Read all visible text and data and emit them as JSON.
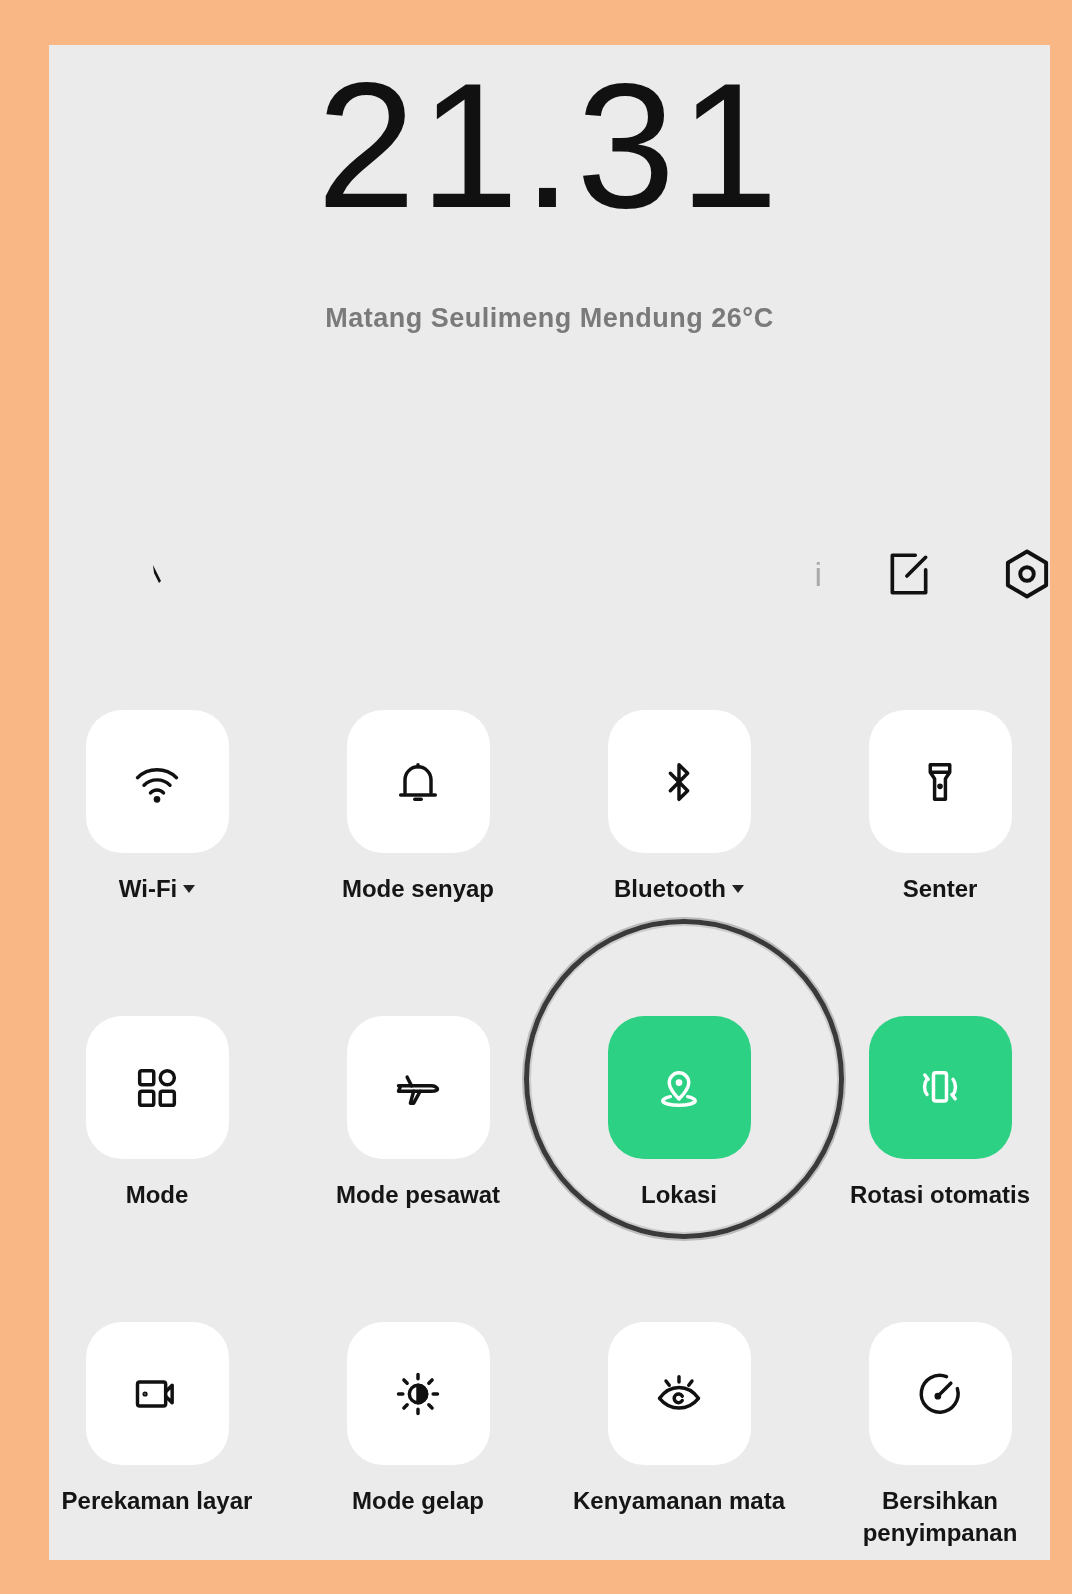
{
  "clock": {
    "time": "21.31",
    "weather": "Matang Seulimeng Mendung 26°C"
  },
  "header": {
    "info": "i"
  },
  "tiles": [
    {
      "label": "Wi-Fi",
      "on": false,
      "menu": true,
      "highlighted": false
    },
    {
      "label": "Mode senyap",
      "on": false,
      "menu": false,
      "highlighted": false
    },
    {
      "label": "Bluetooth",
      "on": false,
      "menu": true,
      "highlighted": false
    },
    {
      "label": "Senter",
      "on": false,
      "menu": false,
      "highlighted": false
    },
    {
      "label": "Mode",
      "on": false,
      "menu": false,
      "highlighted": false
    },
    {
      "label": "Mode pesawat",
      "on": false,
      "menu": false,
      "highlighted": false
    },
    {
      "label": "Lokasi",
      "on": true,
      "menu": false,
      "highlighted": true
    },
    {
      "label": "Rotasi otomatis",
      "on": true,
      "menu": false,
      "highlighted": false
    },
    {
      "label": "Perekaman layar",
      "on": false,
      "menu": false,
      "highlighted": false
    },
    {
      "label": "Mode gelap",
      "on": false,
      "menu": false,
      "highlighted": false
    },
    {
      "label": "Kenyamanan mata",
      "on": false,
      "menu": false,
      "highlighted": false
    },
    {
      "label": "Bersihkan penyimpanan",
      "on": false,
      "menu": false,
      "highlighted": false
    }
  ]
}
